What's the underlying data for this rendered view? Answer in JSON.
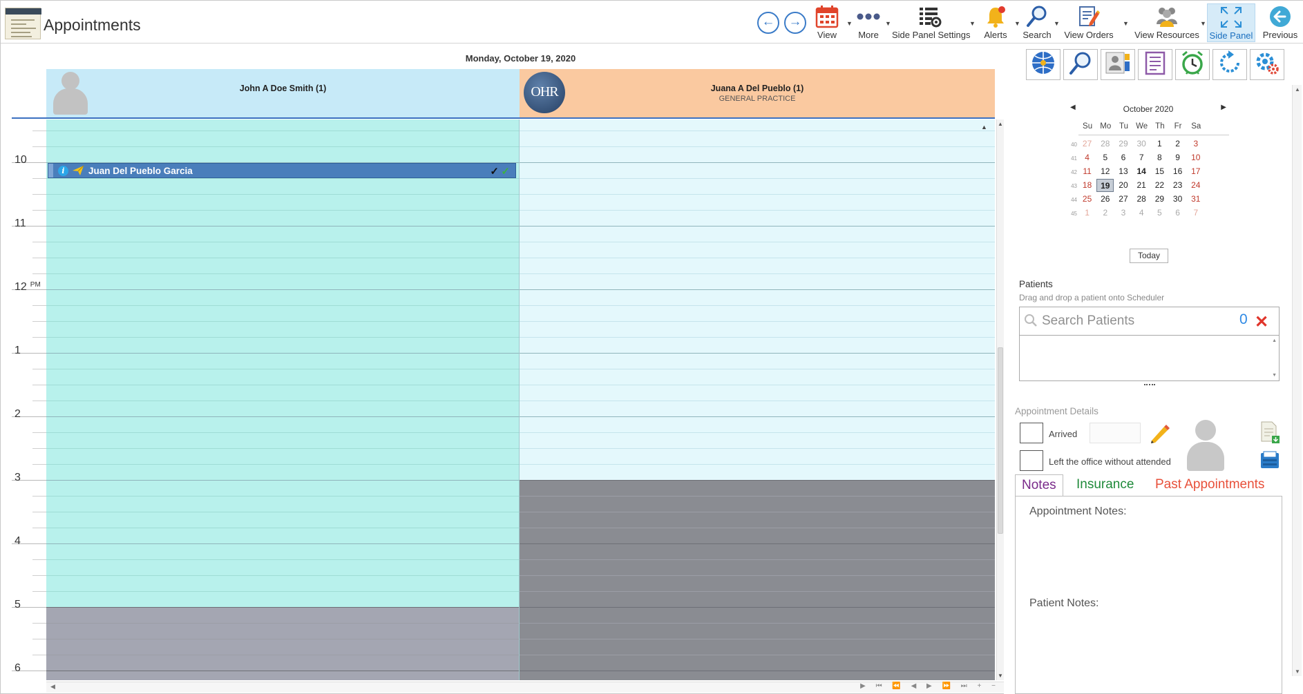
{
  "app": {
    "title": "Appointments"
  },
  "toolbar": {
    "view": "View",
    "more": "More",
    "side_panel_settings": "Side Panel Settings",
    "alerts": "Alerts",
    "search": "Search",
    "view_orders": "View Orders",
    "view_resources": "View Resources",
    "side_panel": "Side Panel",
    "previous": "Previous"
  },
  "scheduler": {
    "date_header": "Monday, October 19, 2020",
    "resources": [
      {
        "name": "John A Doe Smith (1)",
        "subtitle": ""
      },
      {
        "name": "Juana A Del Pueblo (1)",
        "subtitle": "GENERAL PRACTICE",
        "logo_text": "OHR"
      }
    ],
    "hours": [
      {
        "label": "10",
        "suffix": ""
      },
      {
        "label": "11",
        "suffix": ""
      },
      {
        "label": "12",
        "suffix": "PM"
      },
      {
        "label": "1",
        "suffix": ""
      },
      {
        "label": "2",
        "suffix": ""
      },
      {
        "label": "3",
        "suffix": ""
      },
      {
        "label": "4",
        "suffix": ""
      },
      {
        "label": "5",
        "suffix": ""
      },
      {
        "label": "6",
        "suffix": ""
      }
    ],
    "appointment": {
      "patient": "Juan Del Pueblo Garcia",
      "resource": 0,
      "info_glyph": "i"
    },
    "colors": {
      "john_available": "#b8f1ec",
      "juana_available": "#e4f8fc",
      "john_unavailable": "#a4a6b2",
      "juana_unavailable": "#8a8c92",
      "appointment": "#4a7ebb"
    }
  },
  "side_panel": {
    "tool_icons": [
      "globe-icon",
      "magnify-icon",
      "contact-card-icon",
      "checklist-icon",
      "alarm-clock-icon",
      "refresh-icon",
      "settings-gear-icon"
    ],
    "calendar": {
      "month_label": "October 2020",
      "weekdays": [
        "Su",
        "Mo",
        "Tu",
        "We",
        "Th",
        "Fr",
        "Sa"
      ],
      "weeks": [
        {
          "num": "40",
          "days": [
            {
              "d": "27",
              "other": true
            },
            {
              "d": "28",
              "other": true
            },
            {
              "d": "29",
              "other": true
            },
            {
              "d": "30",
              "other": true
            },
            {
              "d": "1"
            },
            {
              "d": "2"
            },
            {
              "d": "3"
            }
          ]
        },
        {
          "num": "41",
          "days": [
            {
              "d": "4"
            },
            {
              "d": "5"
            },
            {
              "d": "6"
            },
            {
              "d": "7"
            },
            {
              "d": "8"
            },
            {
              "d": "9"
            },
            {
              "d": "10"
            }
          ]
        },
        {
          "num": "42",
          "days": [
            {
              "d": "11"
            },
            {
              "d": "12"
            },
            {
              "d": "13"
            },
            {
              "d": "14",
              "today": true
            },
            {
              "d": "15"
            },
            {
              "d": "16"
            },
            {
              "d": "17"
            }
          ]
        },
        {
          "num": "43",
          "days": [
            {
              "d": "18"
            },
            {
              "d": "19",
              "selected": true
            },
            {
              "d": "20"
            },
            {
              "d": "21"
            },
            {
              "d": "22"
            },
            {
              "d": "23"
            },
            {
              "d": "24"
            }
          ]
        },
        {
          "num": "44",
          "days": [
            {
              "d": "25"
            },
            {
              "d": "26"
            },
            {
              "d": "27"
            },
            {
              "d": "28"
            },
            {
              "d": "29"
            },
            {
              "d": "30"
            },
            {
              "d": "31"
            }
          ]
        },
        {
          "num": "45",
          "days": [
            {
              "d": "1",
              "other": true
            },
            {
              "d": "2",
              "other": true
            },
            {
              "d": "3",
              "other": true
            },
            {
              "d": "4",
              "other": true
            },
            {
              "d": "5",
              "other": true
            },
            {
              "d": "6",
              "other": true
            },
            {
              "d": "7",
              "other": true
            }
          ]
        }
      ],
      "today_button": "Today"
    },
    "patients": {
      "label": "Patients",
      "hint": "Drag and drop a patient onto Scheduler",
      "search_placeholder": "Search Patients",
      "search_value": "",
      "count": "0"
    },
    "appointment_details": {
      "label": "Appointment Details",
      "arrived_label": "Arrived",
      "arrived_value": "",
      "left_label": "Left the office without attended"
    },
    "tabs": [
      {
        "label": "Notes",
        "color": "#7a2a8a",
        "active": true
      },
      {
        "label": "Insurance",
        "color": "#1f8a3a",
        "active": false
      },
      {
        "label": "Past Appointments",
        "color": "#e8503a",
        "active": false
      }
    ],
    "notes": {
      "appointment_notes_label": "Appointment Notes:",
      "patient_notes_label": "Patient Notes:"
    }
  }
}
